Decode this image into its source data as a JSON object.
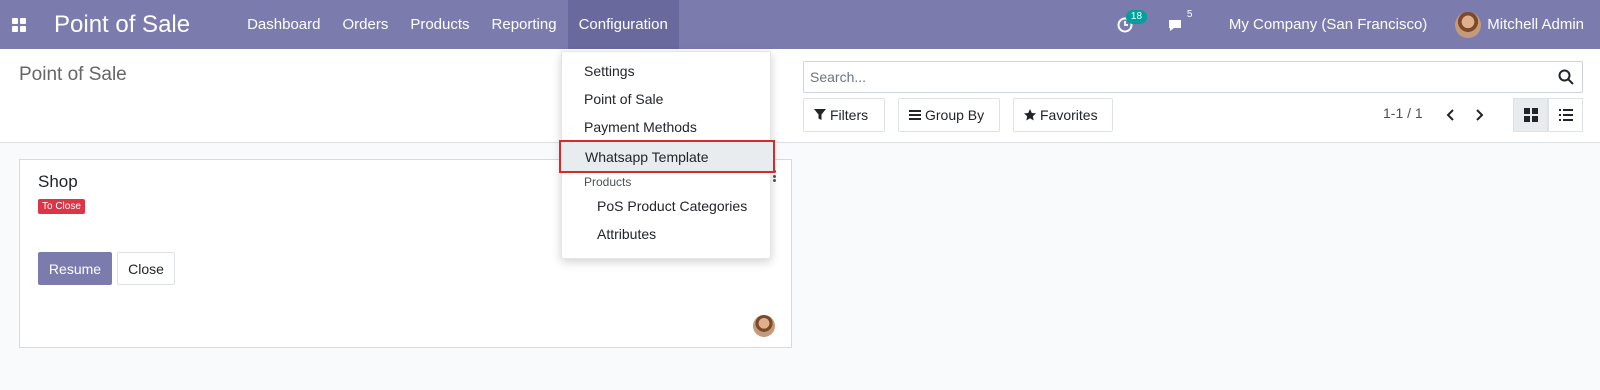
{
  "navbar": {
    "app_name": "Point of Sale",
    "menu": [
      "Dashboard",
      "Orders",
      "Products",
      "Reporting",
      "Configuration"
    ],
    "activity_count": "18",
    "message_count": "5",
    "company": "My Company (San Francisco)",
    "user": "Mitchell Admin",
    "colors": {
      "brand": "#7c7bad",
      "badge": "#00a09d"
    }
  },
  "control_panel": {
    "breadcrumb": "Point of Sale",
    "search_placeholder": "Search...",
    "filters_label": "Filters",
    "group_by_label": "Group By",
    "favorites_label": "Favorites",
    "pager": "1-1 / 1"
  },
  "dropdown": {
    "items": [
      "Settings",
      "Point of Sale",
      "Payment Methods",
      "Whatsapp Template"
    ],
    "section_header": "Products",
    "sub_items": [
      "PoS Product Categories",
      "Attributes"
    ]
  },
  "card": {
    "title": "Shop",
    "status": "To Close",
    "resume_label": "Resume",
    "close_label": "Close",
    "status_color": "#dc3545"
  }
}
